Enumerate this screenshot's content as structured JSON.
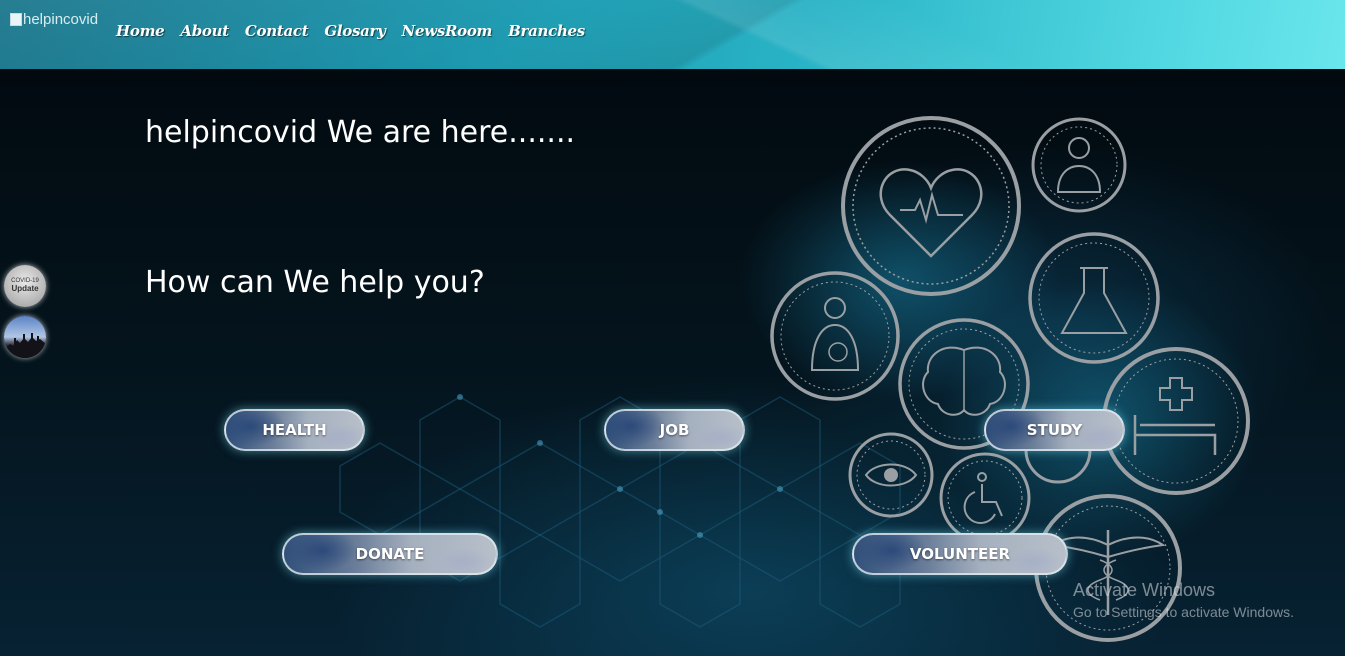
{
  "nav": {
    "logo_alt": "helpincovid",
    "items": [
      {
        "label": "Home"
      },
      {
        "label": "About"
      },
      {
        "label": "Contact"
      },
      {
        "label": "Glosary"
      },
      {
        "label": "NewsRoom"
      },
      {
        "label": "Branches"
      }
    ]
  },
  "hero": {
    "title": "helpincovid We are here.......",
    "subtitle": "How can We help you?"
  },
  "side_icons": {
    "covid": {
      "line1": "COVID-19",
      "line2": "Update",
      "icon": "covid-update-icon"
    },
    "community": {
      "icon": "people-silhouette-icon"
    }
  },
  "buttons": [
    {
      "label": "HEALTH"
    },
    {
      "label": "JOB"
    },
    {
      "label": "STUDY"
    },
    {
      "label": "DONATE"
    },
    {
      "label": "VOLUNTEER"
    }
  ],
  "decor_icons": [
    "heart-pulse-icon",
    "doctor-icon",
    "flask-icon",
    "pregnancy-icon",
    "brain-icon",
    "hospital-bed-icon",
    "eye-icon",
    "wheelchair-icon",
    "caduceus-icon"
  ],
  "watermark": {
    "title": "Activate Windows",
    "text": "Go to Settings to activate Windows."
  },
  "colors": {
    "nav_accent": "#29b3c6",
    "background": "#031018",
    "button_glow": "#78dcf0"
  }
}
